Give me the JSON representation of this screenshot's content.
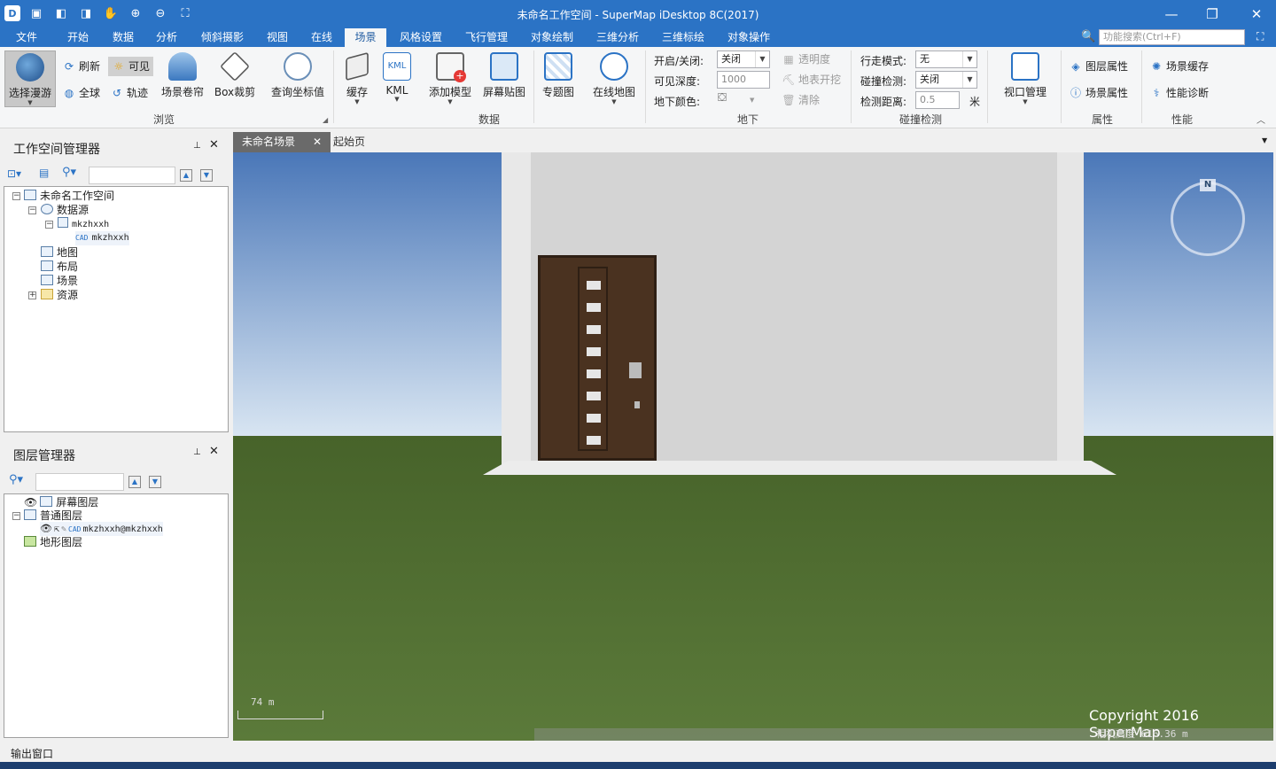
{
  "window": {
    "title": "未命名工作空间 - SuperMap iDesktop 8C(2017)"
  },
  "quick_access": [
    "app-logo-icon",
    "save-icon",
    "open-icon",
    "new-icon",
    "pan-icon",
    "zoom-in-icon",
    "zoom-out-icon",
    "full-extent-icon"
  ],
  "menu": {
    "tabs": [
      "文件",
      "开始",
      "数据",
      "分析",
      "倾斜摄影",
      "视图",
      "在线",
      "场景",
      "风格设置",
      "飞行管理",
      "对象绘制",
      "三维分析",
      "三维标绘",
      "对象操作"
    ],
    "active": "场景",
    "search_placeholder": "功能搜索(Ctrl+F)"
  },
  "ribbon": {
    "browse": {
      "label": "浏览",
      "select_roam": "选择漫游",
      "refresh": "刷新",
      "visible": "可见",
      "globe": "全球",
      "track": "轨迹",
      "scene_roll": "场景卷帘",
      "box_clip": "Box裁剪",
      "query_coord": "查询坐标值"
    },
    "data": {
      "label": "数据",
      "cache": "缓存",
      "kml": "KML",
      "add_model": "添加模型",
      "screen_map": "屏幕贴图",
      "thematic": "专题图",
      "online_map": "在线地图"
    },
    "underground": {
      "label": "地下",
      "onoff_label": "开启/关闭:",
      "onoff_value": "关闭",
      "depth_label": "可见深度:",
      "depth_value": "1000",
      "color_label": "地下颜色:",
      "transparency": "透明度",
      "surface_dig": "地表开挖",
      "clear": "清除"
    },
    "collision": {
      "label": "碰撞检测",
      "walk_mode_label": "行走模式:",
      "walk_mode_value": "无",
      "detect_label": "碰撞检测:",
      "detect_value": "关闭",
      "distance_label": "检测距离:",
      "distance_value": "0.5",
      "distance_unit": "米"
    },
    "viewport": {
      "label": "视口管理"
    },
    "properties": {
      "label": "属性",
      "layer_props": "图层属性",
      "scene_props": "场景属性"
    },
    "performance": {
      "label": "性能",
      "scene_cache": "场景缓存",
      "perf_diag": "性能诊断"
    }
  },
  "workspace_panel": {
    "title": "工作空间管理器",
    "tree": {
      "workspace": "未命名工作空间",
      "datasources": "数据源",
      "datasource": "mkzhxxh",
      "dataset_prefix": "CAD",
      "dataset": "mkzhxxh",
      "maps": "地图",
      "layouts": "布局",
      "scenes": "场景",
      "resources": "资源"
    }
  },
  "layer_panel": {
    "title": "图层管理器",
    "screen_layers": "屏幕图层",
    "normal_layers": "普通图层",
    "layer_prefix": "CAD",
    "layer_name": "mkzhxxh@mkzhxxh",
    "terrain_layers": "地形图层"
  },
  "doc_tabs": {
    "active": "未命名场景",
    "other": "起始页"
  },
  "scene": {
    "scale_value": "74",
    "scale_unit": "m",
    "copyright": "Copyright 2016 SuperMap",
    "camera_height": "相机高度 616.36 m",
    "compass_label": "N",
    "colors": {
      "sky_top": "#4a77b8",
      "sky_bottom": "#d8e5f2",
      "ground": "#47632a",
      "door": "#4a3220"
    }
  },
  "status": {
    "output_window": "输出窗口"
  }
}
